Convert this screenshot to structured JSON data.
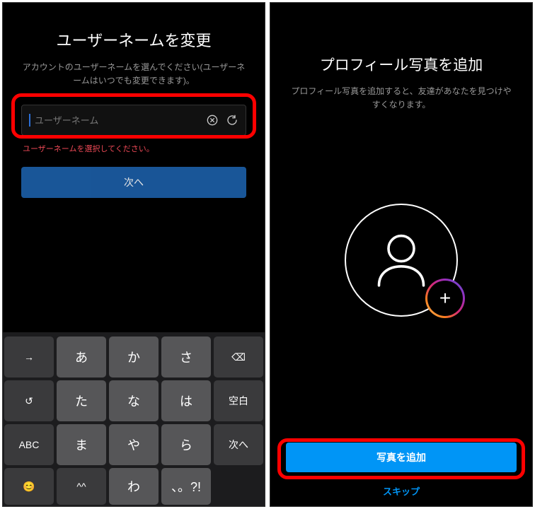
{
  "s1": {
    "title": "ユーザーネームを変更",
    "subtitle": "アカウントのユーザーネームを選んでください(ユーザーネームはいつでも変更できます)。",
    "input_placeholder": "ユーザーネーム",
    "input_value": "",
    "error": "ユーザーネームを選択してください。",
    "next_label": "次へ"
  },
  "s2": {
    "title": "プロフィール写真を追加",
    "subtitle": "プロフィール写真を追加すると、友達があなたを見つけやすくなります。",
    "add_label": "写真を追加",
    "skip_label": "スキップ"
  },
  "keyboard": {
    "rows": [
      [
        "→",
        "あ",
        "か",
        "さ",
        "⌫"
      ],
      [
        "↺",
        "た",
        "な",
        "は",
        "空白"
      ],
      [
        "ABC",
        "ま",
        "や",
        "ら",
        "次へ"
      ],
      [
        "😊",
        "^^",
        "わ",
        "、。?!",
        ""
      ]
    ],
    "fn_indices": [
      [
        0,
        4
      ],
      [
        0,
        4
      ],
      [
        0,
        4
      ],
      [
        0,
        1,
        4
      ]
    ]
  }
}
